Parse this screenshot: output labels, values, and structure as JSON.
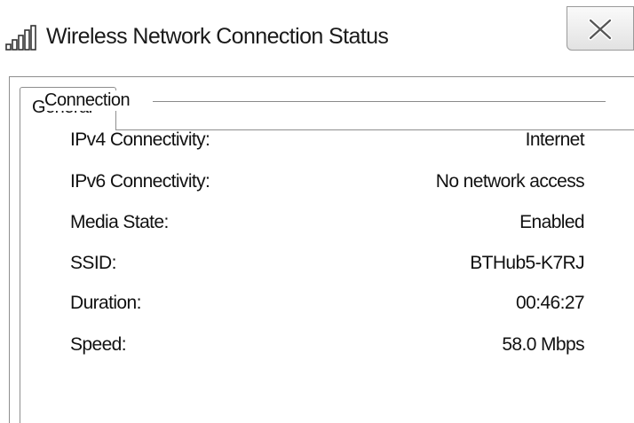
{
  "window": {
    "title": "Wireless Network Connection Status",
    "icon": "wireless-signal-icon",
    "close_icon": "close-icon"
  },
  "tabs": [
    {
      "label": "General",
      "selected": true
    }
  ],
  "connection": {
    "group_label": "Connection",
    "rows": [
      {
        "label": "IPv4 Connectivity:",
        "value": "Internet"
      },
      {
        "label": "IPv6 Connectivity:",
        "value": "No network access"
      },
      {
        "label": "Media State:",
        "value": "Enabled"
      },
      {
        "label": "SSID:",
        "value": "BTHub5-K7RJ"
      },
      {
        "label": "Duration:",
        "value": "00:46:27"
      },
      {
        "label": "Speed:",
        "value": "58.0 Mbps"
      }
    ]
  }
}
